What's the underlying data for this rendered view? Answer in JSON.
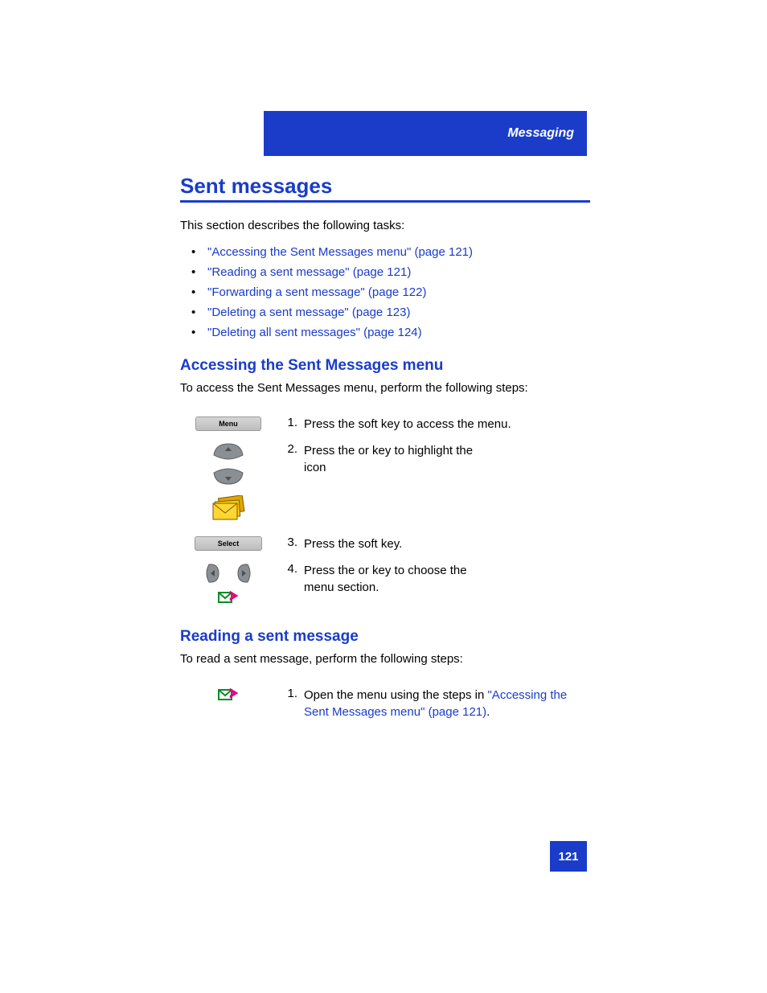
{
  "header": {
    "section": "Messaging"
  },
  "title": "Sent messages",
  "intro": "This section describes the following tasks:",
  "toc": [
    "\"Accessing the Sent Messages menu\" (page 121)",
    "\"Reading a sent message\" (page 121)",
    "\"Forwarding a sent message\" (page 122)",
    "\"Deleting a sent message\" (page 123)",
    "\"Deleting all sent messages\" (page 124)"
  ],
  "section1": {
    "heading": "Accessing the Sent Messages menu",
    "intro": "To access the Sent Messages menu, perform the following steps:",
    "softkeys": {
      "menu": "Menu",
      "select": "Select"
    },
    "steps": {
      "1": {
        "num": "1.",
        "text": "Press the         soft key to access the          menu."
      },
      "2": {
        "num": "2.",
        "text_a": "Press the        or           key to highlight the",
        "text_b": "                 icon"
      },
      "3": {
        "num": "3.",
        "text": "Press the           soft key."
      },
      "4": {
        "num": "4.",
        "text_a": "Press the        or           key to choose the",
        "text_b": "          menu section."
      }
    }
  },
  "section2": {
    "heading": "Reading a sent message",
    "intro": "To read a sent message, perform the following steps:",
    "steps": {
      "1": {
        "num": "1.",
        "text_a": "Open the           menu using the steps in ",
        "link": "\"Accessing the Sent Messages menu\" (page 121)",
        "text_b": "."
      }
    }
  },
  "page_number": "121"
}
